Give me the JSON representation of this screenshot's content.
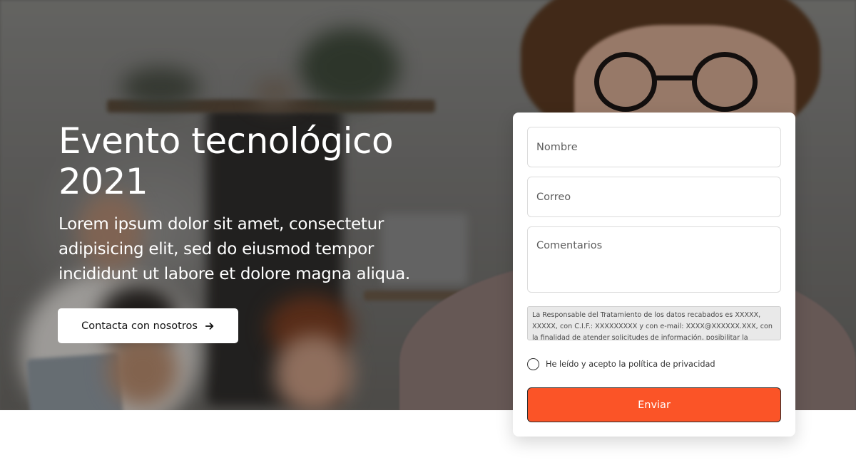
{
  "hero": {
    "title": "Evento tecnológico 2021",
    "description": "Lorem ipsum dolor sit amet, consectetur adipisicing elit, sed do eiusmod tempor incididunt ut labore et dolore magna aliqua.",
    "cta_label": "Contacta con nosotros",
    "cta_icon": "arrow-right-icon"
  },
  "form": {
    "name_placeholder": "Nombre",
    "email_placeholder": "Correo",
    "comments_placeholder": "Comentarios",
    "legal_text": "La Responsable del Tratamiento de los datos recabados es XXXXX, XXXXX, con C.I.F.: XXXXXXXXX y con e-mail: XXXX@XXXXXX.XXX, con la finalidad de atender solicitudes de información, posibilitar la publicación de tus",
    "consent_label": "He leído y acepto la política de privacidad",
    "consent_checked": false,
    "submit_label": "Enviar"
  },
  "colors": {
    "accent": "#fb5427",
    "card_bg": "#ffffff",
    "legal_bg": "#e9e9e9"
  }
}
